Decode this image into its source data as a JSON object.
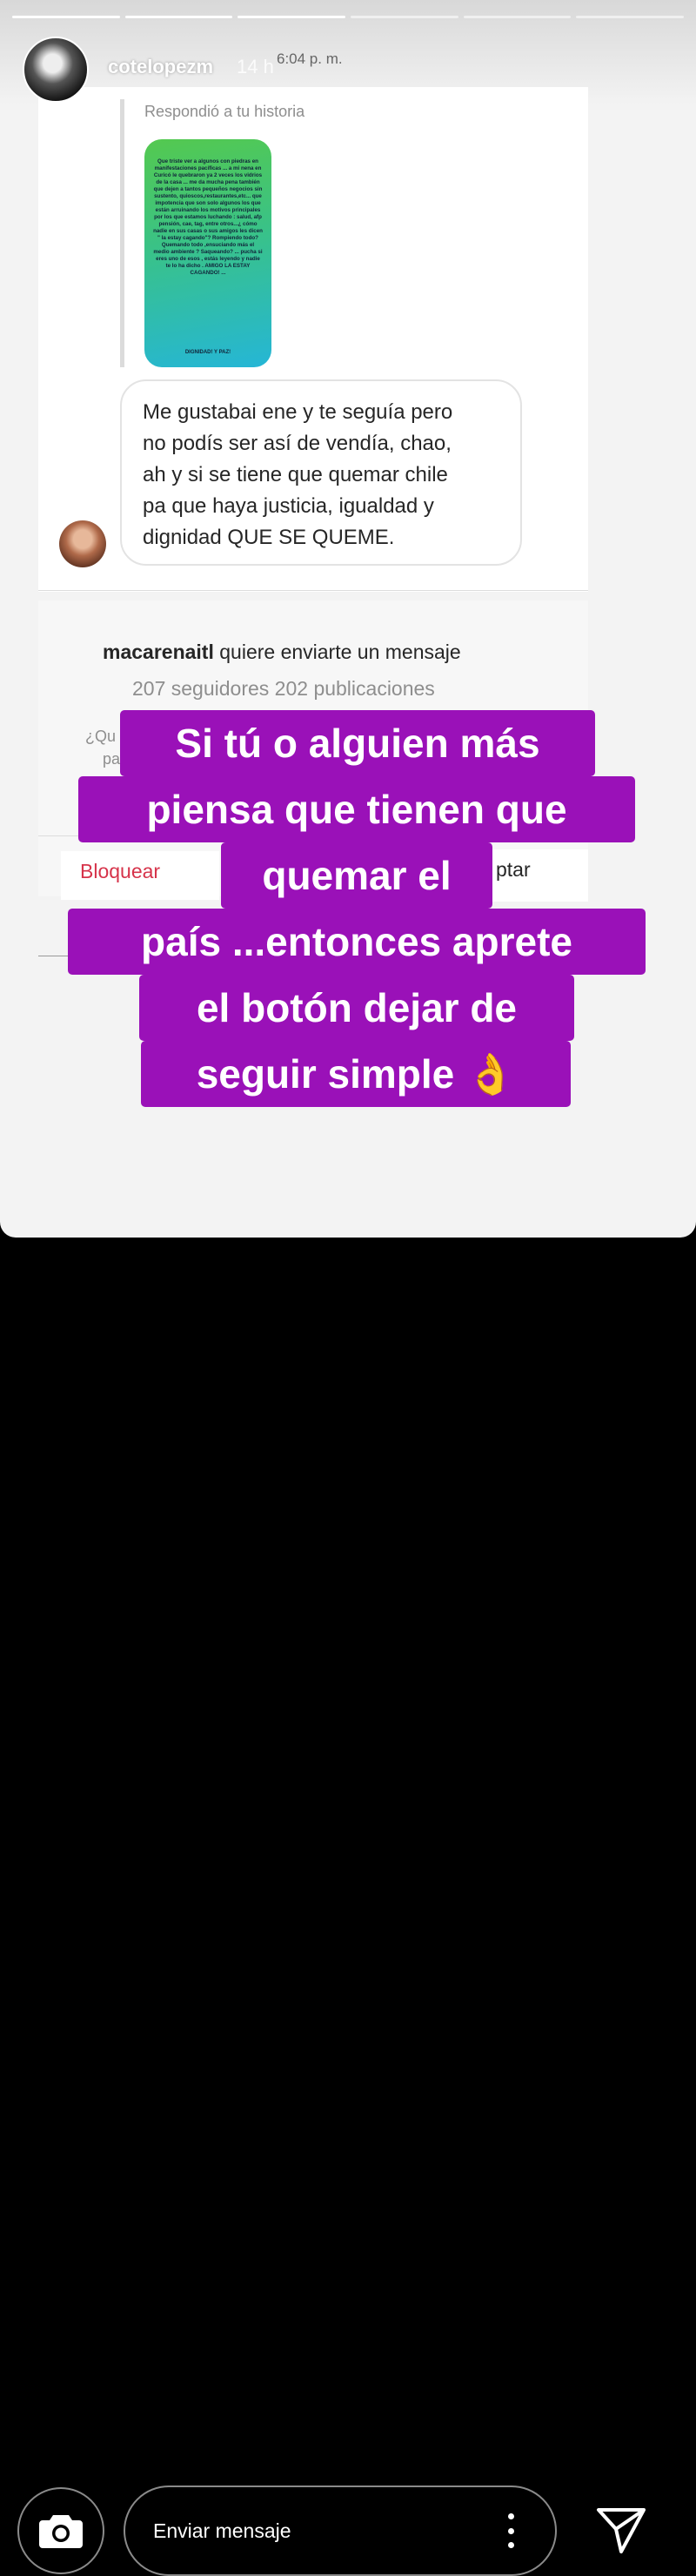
{
  "story": {
    "username": "cotelopezm",
    "time_ago": "14 h",
    "progress_segments": 6,
    "progress_done": 3
  },
  "dm": {
    "timestamp": "6:04 p. m.",
    "reply_label": "Respondió a tu historia",
    "shared_story_text": "Que triste ver a algunos con piedras en manifestaciones pacíficas ... a mi nena en Curicó le quebraron ya 2 veces los vidrios de la casa ... me da mucha pena también que dejen a tantos pequeños negocios sin sustento, quioscos,restaurantes,etc... que impotencia que son solo algunos los que están arruinando los motivos principales por los que estamos luchando : salud, afp pensión, cae, tag, entre otros...¿ cómo nadie en sus casas o sus amigos les dicen \" la estay cagando\"? Rompiendo todo? Quemando todo ,ensuciando más el medio ambiente ? Saqueando? ... pucha si eres uno de esos , estás leyendo y nadie te lo ha dicho . AMIGO LA ESTAY CAGANDO! ...",
    "shared_story_footer": "DIGNIDAD! Y PAZ!",
    "message_lines": [
      "Me gustabai ene y te seguía pero",
      "no podís ser así de vendía, chao,",
      "ah y si se tiene que quemar chile",
      "pa que haya justicia, igualdad y",
      "dignidad QUE SE QUEME."
    ]
  },
  "request": {
    "username": "macarenaitl",
    "title_rest": "quiere enviarte un mensaje",
    "stats": "207 seguidores 202 publicaciones",
    "question_fragment": "¿Qu",
    "line_fragment": "pa",
    "block_label": "Bloquear",
    "accept_fragment": "ptar"
  },
  "caption": {
    "lines": [
      "Si tú o alguien más",
      "piensa que tienen que",
      "quemar el",
      "país ...entonces aprete",
      "el botón dejar de",
      "seguir simple 👌"
    ],
    "background_color": "#9a11b8"
  },
  "reply_bar": {
    "placeholder": "Enviar mensaje",
    "camera_icon": "camera-icon",
    "more_icon": "more-vertical-icon",
    "send_icon": "send-icon"
  }
}
